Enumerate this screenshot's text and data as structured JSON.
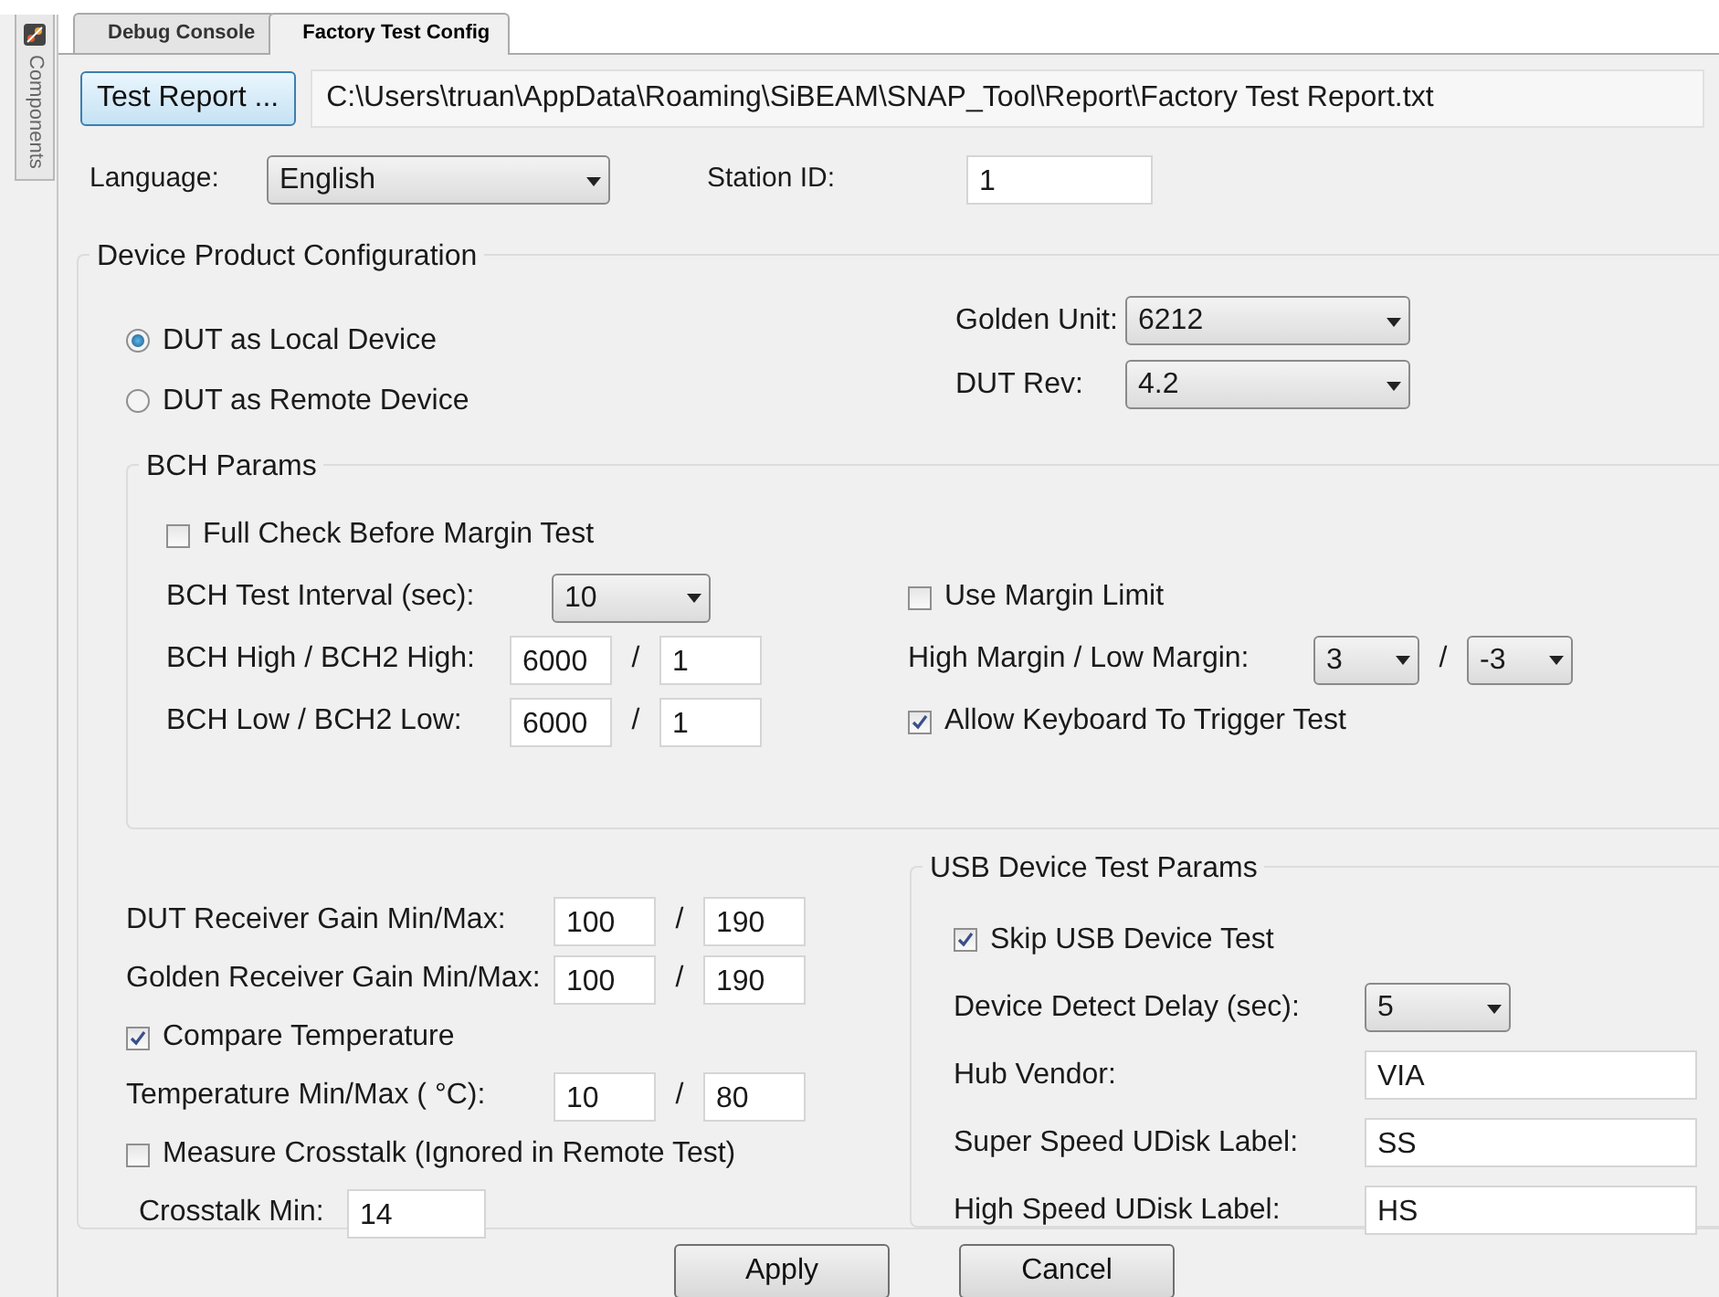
{
  "side_panel": {
    "tab": "Components"
  },
  "tabs": [
    {
      "label": "Debug Console",
      "selected": false
    },
    {
      "label": "Factory Test Config",
      "selected": true
    }
  ],
  "report": {
    "button": "Test Report ...",
    "path": "C:\\Users\\truan\\AppData\\Roaming\\SiBEAM\\SNAP_Tool\\Report\\Factory Test Report.txt"
  },
  "language": {
    "label": "Language:",
    "value": "English"
  },
  "station": {
    "label": "Station ID:",
    "value": "1"
  },
  "device_config": {
    "title": "Device Product Configuration",
    "radios": [
      {
        "label": "DUT as Local Device",
        "selected": true
      },
      {
        "label": "DUT as Remote Device",
        "selected": false
      }
    ],
    "selects": [
      {
        "label": "Golden Unit:",
        "value": "6212"
      },
      {
        "label": "DUT Rev:",
        "value": "4.2"
      }
    ],
    "bch_params": {
      "title": "BCH Params",
      "left_rows": [
        {
          "kind": "check",
          "label": "Full Check Before Margin Test",
          "checked": false
        },
        {
          "kind": "select",
          "label": "BCH Test Interval (sec):",
          "value": "10"
        },
        {
          "kind": "pair",
          "label": "BCH High / BCH2 High:",
          "values": [
            "6000",
            "1"
          ],
          "separator": "/"
        },
        {
          "kind": "pair",
          "label": "BCH Low / BCH2 Low:",
          "values": [
            "6000",
            "1"
          ],
          "separator": "/"
        }
      ],
      "right_rows": [
        {
          "kind": "check",
          "label": "Use Margin Limit",
          "checked": false
        },
        {
          "kind": "select_pair",
          "label": "High Margin / Low Margin:",
          "values": [
            "3",
            "-3"
          ],
          "separator": "/"
        },
        {
          "kind": "check",
          "label": "Allow Keyboard To Trigger Test",
          "checked": true
        }
      ]
    },
    "lower_rows": [
      {
        "kind": "pair",
        "label": "DUT Receiver Gain Min/Max:",
        "values": [
          "100",
          "190"
        ],
        "separator": "/"
      },
      {
        "kind": "pair",
        "label": "Golden Receiver Gain Min/Max:",
        "values": [
          "100",
          "190"
        ],
        "separator": "/"
      },
      {
        "kind": "check",
        "label": "Compare Temperature",
        "checked": true
      },
      {
        "kind": "pair",
        "label": "Temperature Min/Max ( °C):",
        "values": [
          "10",
          "80"
        ],
        "separator": "/"
      },
      {
        "kind": "check",
        "label": "Measure Crosstalk (Ignored in Remote Test)",
        "checked": false
      },
      {
        "kind": "input",
        "label": "Crosstalk Min:",
        "value": "14"
      }
    ],
    "usb_params": {
      "title": "USB Device Test Params",
      "rows": [
        {
          "kind": "check",
          "label": "Skip USB Device Test",
          "checked": true
        },
        {
          "kind": "select",
          "label": "Device Detect Delay (sec):",
          "value": "5"
        },
        {
          "kind": "input",
          "label": "Hub Vendor:",
          "value": "VIA"
        },
        {
          "kind": "input",
          "label": "Super Speed UDisk Label:",
          "value": "SS"
        },
        {
          "kind": "input",
          "label": "High Speed UDisk Label:",
          "value": "HS"
        }
      ]
    }
  },
  "buttons": [
    "Apply",
    "Cancel"
  ]
}
